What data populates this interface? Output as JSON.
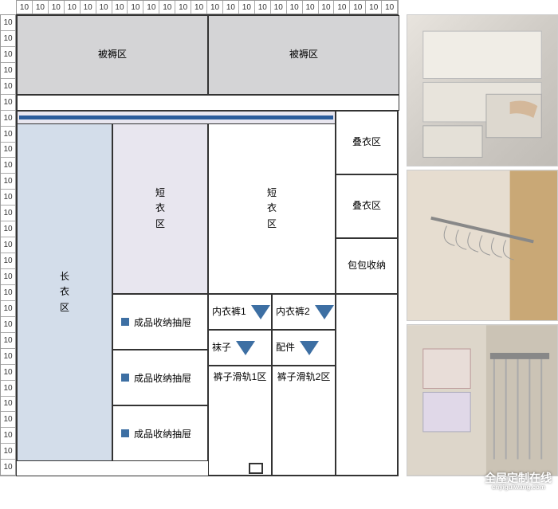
{
  "ruler": {
    "unit": "10",
    "top_count": 24,
    "left_count": 29
  },
  "zones": {
    "quilt_left": "被褥区",
    "quilt_right": "被褥区",
    "long_clothes": "长\n衣\n区",
    "short_clothes_1": "短\n衣\n区",
    "short_clothes_2": "短\n衣\n区",
    "fold_1": "叠衣区",
    "fold_2": "叠衣区",
    "bags": "包包收纳",
    "drawer_1": "成品收纳抽屉",
    "drawer_2": "成品收纳抽屉",
    "drawer_3": "成品收纳抽屉",
    "underwear_1": "内衣裤1",
    "underwear_2": "内衣裤2",
    "socks": "袜子",
    "accessories": "配件",
    "pants_rail_1": "裤子滑轨1区",
    "pants_rail_2": "裤子滑轨2区"
  },
  "photos": {
    "alt_1": "storage boxes",
    "alt_2": "hanger rail",
    "alt_3": "pants hanger"
  },
  "watermark": {
    "main": "全屋定制在线",
    "sub": "cnyiguiwang.com"
  }
}
